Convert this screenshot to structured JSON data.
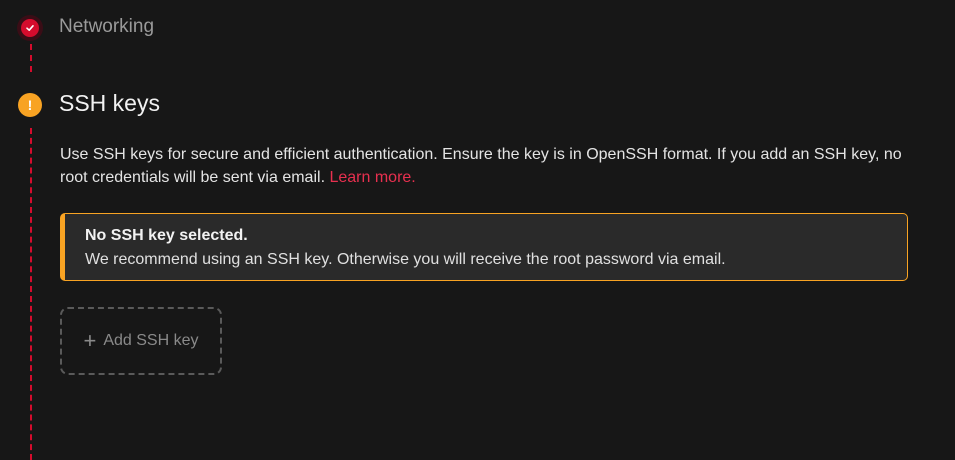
{
  "steps": {
    "networking": {
      "title": "Networking",
      "status_icon": "check-icon",
      "accent": "#d50c2d"
    },
    "ssh": {
      "title": "SSH keys",
      "status_icon": "exclamation-icon",
      "accent": "#f8a323",
      "description": "Use SSH keys for secure and efficient authentication. Ensure the key is in OpenSSH format. If you add an SSH key, no root credentials will be sent via email.",
      "learn_more": "Learn more.",
      "alert": {
        "title": "No SSH key selected.",
        "text": "We recommend using an SSH key. Otherwise you will receive the root password via email."
      },
      "add_button": "Add SSH key",
      "add_icon": "plus-icon"
    }
  }
}
